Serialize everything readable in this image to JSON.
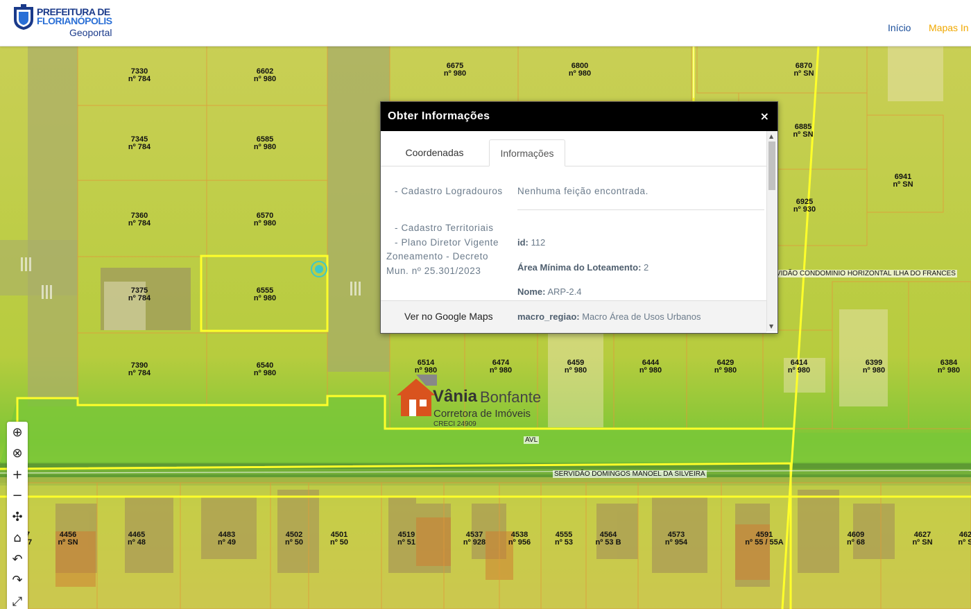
{
  "header": {
    "logo_line1": "PREFEITURA DE",
    "logo_line2": "FLORIANÓPOLIS",
    "logo_sub": "Geoportal",
    "nav": [
      "Início",
      "Mapas In"
    ]
  },
  "colors": {
    "brand_blue": "#1a3a8a",
    "nav_accent": "#f0a800",
    "highlight_yellow": "#ffff33",
    "map_green": "#7ec83a"
  },
  "map": {
    "lots": [
      {
        "id": "7330",
        "num": "nº 784"
      },
      {
        "id": "6602",
        "num": "nº 980"
      },
      {
        "id": "6675",
        "num": "nº 980"
      },
      {
        "id": "6800",
        "num": "nº 980"
      },
      {
        "id": "6870",
        "num": "nº SN"
      },
      {
        "id": "7345",
        "num": "nº 784"
      },
      {
        "id": "6585",
        "num": "nº 980"
      },
      {
        "id": "6885",
        "num": "nº SN"
      },
      {
        "id": "6941",
        "num": "nº SN"
      },
      {
        "id": "7360",
        "num": "nº 784"
      },
      {
        "id": "6570",
        "num": "nº 980"
      },
      {
        "id": "6925",
        "num": "nº 930"
      },
      {
        "id": "7375",
        "num": "nº 784"
      },
      {
        "id": "6555",
        "num": "nº 980"
      },
      {
        "id": "7390",
        "num": "nº 784"
      },
      {
        "id": "6540",
        "num": "nº 980"
      },
      {
        "id": "6514",
        "num": "nº 980"
      },
      {
        "id": "6474",
        "num": "nº 980"
      },
      {
        "id": "6459",
        "num": "nº 980"
      },
      {
        "id": "6444",
        "num": "nº 980"
      },
      {
        "id": "6429",
        "num": "nº 980"
      },
      {
        "id": "6414",
        "num": "nº 980"
      },
      {
        "id": "6399",
        "num": "nº 980"
      },
      {
        "id": "6384",
        "num": "nº 980"
      },
      {
        "id": "7",
        "num": "37"
      },
      {
        "id": "4456",
        "num": "nº SN"
      },
      {
        "id": "4465",
        "num": "nº 48"
      },
      {
        "id": "4483",
        "num": "nº 49"
      },
      {
        "id": "4502",
        "num": "nº 50"
      },
      {
        "id": "4501",
        "num": "nº 50"
      },
      {
        "id": "4519",
        "num": "nº 51"
      },
      {
        "id": "4537",
        "num": "nº 928"
      },
      {
        "id": "4538",
        "num": "nº 956"
      },
      {
        "id": "4555",
        "num": "nº 53"
      },
      {
        "id": "4564",
        "num": "nº 53 B"
      },
      {
        "id": "4573",
        "num": "nº 954"
      },
      {
        "id": "4591",
        "num": "nº 55 / 55A"
      },
      {
        "id": "4609",
        "num": "nº 68"
      },
      {
        "id": "4627",
        "num": "nº SN"
      },
      {
        "id": "462",
        "num": "nº S"
      }
    ],
    "streets": {
      "avl": "AVL",
      "servidao_domingos": "SERVIDÃO DOMINGOS MANOEL DA SILVEIRA",
      "servidao_condominio": "RVIDÃO CONDOMINIO HORIZONTAL ILHA DO FRANCES"
    },
    "brand": {
      "name1": "Vânia",
      "name2": "Bonfante",
      "sub": "Corretora de Imóveis",
      "creci": "CRECI 24909"
    }
  },
  "toolbar": {
    "tools": [
      {
        "name": "globe-icon",
        "glyph": "⊕"
      },
      {
        "name": "identify-icon",
        "glyph": "⊗"
      },
      {
        "name": "zoom-in-icon",
        "glyph": "+"
      },
      {
        "name": "zoom-out-icon",
        "glyph": "−"
      },
      {
        "name": "pan-icon",
        "glyph": "✣"
      },
      {
        "name": "home-icon",
        "glyph": "⌂"
      },
      {
        "name": "undo-icon",
        "glyph": "↶"
      },
      {
        "name": "redo-icon",
        "glyph": "↷"
      },
      {
        "name": "fullscreen-icon",
        "glyph": "⤢"
      }
    ]
  },
  "popup": {
    "title": "Obter Informações",
    "close": "×",
    "tabs": [
      "Coordenadas",
      "Informações"
    ],
    "active_tab": "Informações",
    "layer1": "- Cadastro Logradouros",
    "layer1_result": "Nenhuma feição encontrada.",
    "layer2_lines": [
      "- Cadastro Territoriais",
      "- Plano Diretor Vigente",
      "Zoneamento - Decreto",
      "Mun. nº 25.301/2023"
    ],
    "attributes": [
      {
        "key": "id:",
        "value": "112"
      },
      {
        "key": "Área Mínima do Loteamento:",
        "value": "2"
      },
      {
        "key": "Nome:",
        "value": "ARP-2.4"
      }
    ],
    "google_maps": "Ver no Google Maps",
    "last_attr_key": "macro_regiao:",
    "last_attr_value": "Macro Área de Usos Urbanos"
  }
}
